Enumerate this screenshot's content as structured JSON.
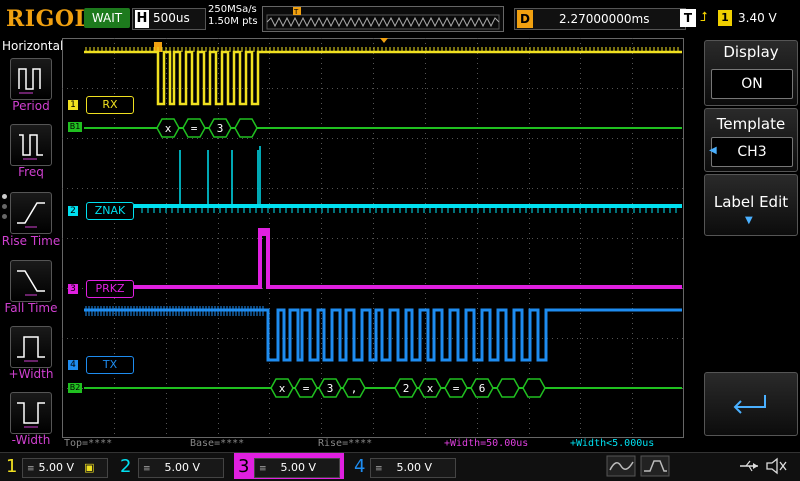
{
  "header": {
    "brand": "RIGOL",
    "run_status": "WAIT",
    "horizontal_key": "H",
    "timebase": "500us",
    "sample_rate": "250MSa/s",
    "memory_depth": "1.50M pts",
    "delay_key": "D",
    "delay_value": "2.27000000ms",
    "trigger_key": "T",
    "trigger_channel": "1",
    "trigger_level": "3.40 V"
  },
  "left_panel": {
    "title": "Horizontal",
    "items": [
      {
        "label": "Period"
      },
      {
        "label": "Freq"
      },
      {
        "label": "Rise Time"
      },
      {
        "label": "Fall Time"
      },
      {
        "label": "+Width"
      },
      {
        "label": "-Width"
      }
    ]
  },
  "channels": [
    {
      "marker": "1",
      "label": "RX",
      "color": "#f0e020"
    },
    {
      "marker": "2",
      "label": "ZNAK",
      "color": "#00e0f0"
    },
    {
      "marker": "3",
      "label": "PRKZ",
      "color": "#e020e0"
    },
    {
      "marker": "4",
      "label": "TX",
      "color": "#1e8cf0"
    }
  ],
  "bus1": {
    "marker": "B1",
    "color": "#20c020",
    "packets": [
      "x",
      "=",
      "3",
      ""
    ]
  },
  "bus2": {
    "marker": "B2",
    "color": "#20c020",
    "packets": [
      "x",
      "=",
      "3",
      ",",
      "2",
      "x",
      "=",
      "6",
      "",
      ""
    ]
  },
  "measurements": {
    "top": "Top=****",
    "base": "Base=****",
    "rise": "Rise=****",
    "pos_width": "+Width=50.00us",
    "pos_width2": "+Width<5.000us"
  },
  "right_menu": {
    "display_label": "Display",
    "display_value": "ON",
    "template_label": "Template",
    "template_value": "CH3",
    "label_edit": "Label Edit"
  },
  "bottom_bar": {
    "ch1": {
      "num": "1",
      "value": "5.00 V",
      "color": "#f0e020"
    },
    "ch2": {
      "num": "2",
      "value": "5.00 V",
      "color": "#00e0f0"
    },
    "ch3": {
      "num": "3",
      "value": "5.00 V",
      "color": "#e020e0"
    },
    "ch4": {
      "num": "4",
      "value": "5.00 V",
      "color": "#1e8cf0"
    }
  },
  "icons": [
    "period-icon",
    "freq-icon",
    "rise-time-icon",
    "fall-time-icon",
    "pos-width-icon",
    "neg-width-icon",
    "return-icon",
    "usb-icon",
    "speaker-mute-icon"
  ]
}
